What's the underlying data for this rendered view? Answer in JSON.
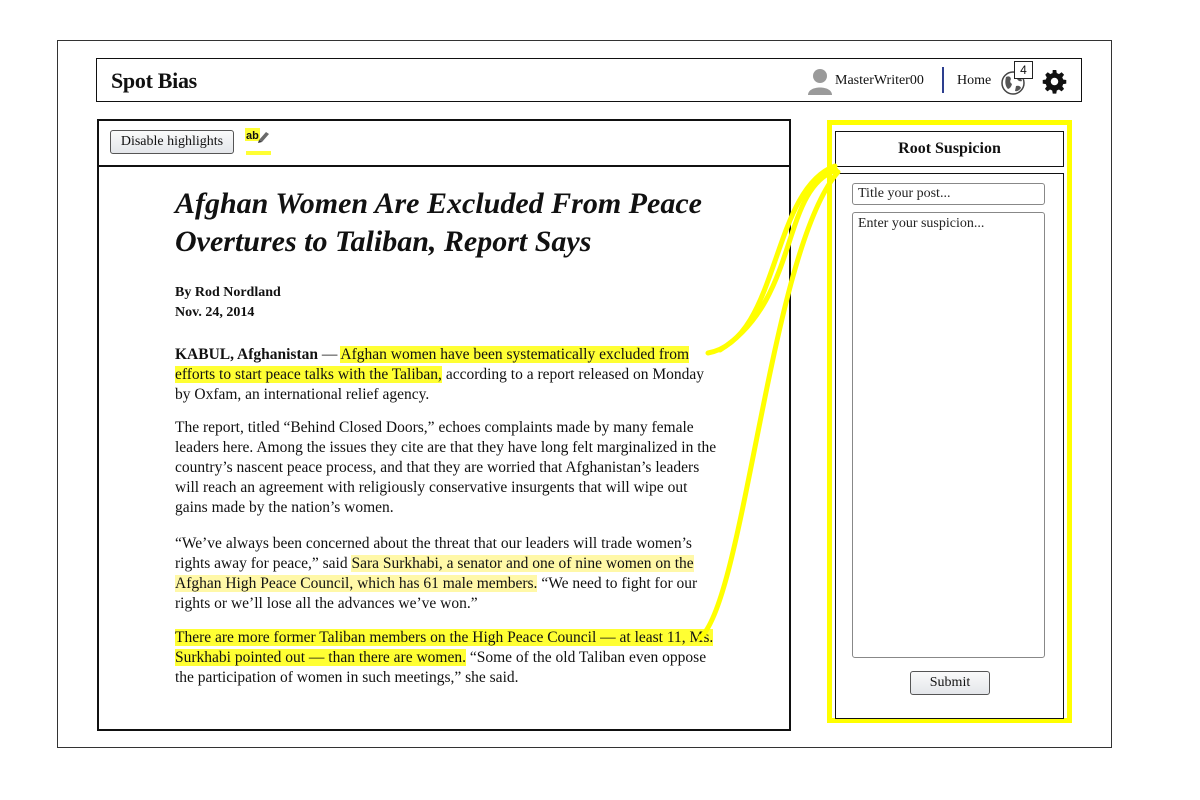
{
  "app": {
    "logo": "Spot Bias",
    "username": "MasterWriter00",
    "home_label": "Home",
    "notification_count": "4",
    "icons": [
      "user-avatar-icon",
      "globe-icon",
      "gear-icon",
      "spellcheck-icon"
    ]
  },
  "toolbar": {
    "disable_highlights_label": "Disable highlights"
  },
  "article": {
    "title": "Afghan Women Are Excluded From Peace Overtures to Taliban, Report Says",
    "byline": "By Rod Nordland",
    "date": "Nov. 24, 2014",
    "p1": {
      "dateline": "KABUL, Afghanistan",
      "dash": " — ",
      "highlight": "Afghan women have been systematically excluded from efforts to start peace talks with the Taliban,",
      "rest": " according to a report released on Monday by Oxfam, an international relief agency."
    },
    "p2": "The report, titled “Behind Closed Doors,” echoes complaints made by many female leaders here. Among the issues they cite are that they have long felt marginalized in the country’s nascent peace process, and that they are worried that Afghanistan’s leaders will reach an agreement with religiously conservative insurgents that will wipe out gains made by the nation’s women.",
    "p3": {
      "before": "“We’ve always been concerned about the threat that our leaders will trade women’s rights away for peace,” said ",
      "highlight": "Sara Surkhabi, a senator and one of nine women on the Afghan High Peace Council, which has 61 male members.",
      "after": " “We need to fight for our rights or we’ll lose all the advances we’ve won.”"
    },
    "p4": {
      "highlight": "There are more former Taliban members on the High Peace Council — at least 11, Ms. Surkhabi pointed out — than there are women.",
      "after": " “Some of the old Taliban even oppose the participation of women in such meetings,” she said."
    }
  },
  "sidebar": {
    "heading": "Root Suspicion",
    "title_placeholder": "Title your post...",
    "suspicion_placeholder": "Enter your suspicion...",
    "submit_label": "Submit"
  },
  "colors": {
    "highlight": "#ffff33",
    "highlight_soft": "#fff8a8",
    "sidebar_border": "#ffff00",
    "divider": "#2d3f8f"
  }
}
